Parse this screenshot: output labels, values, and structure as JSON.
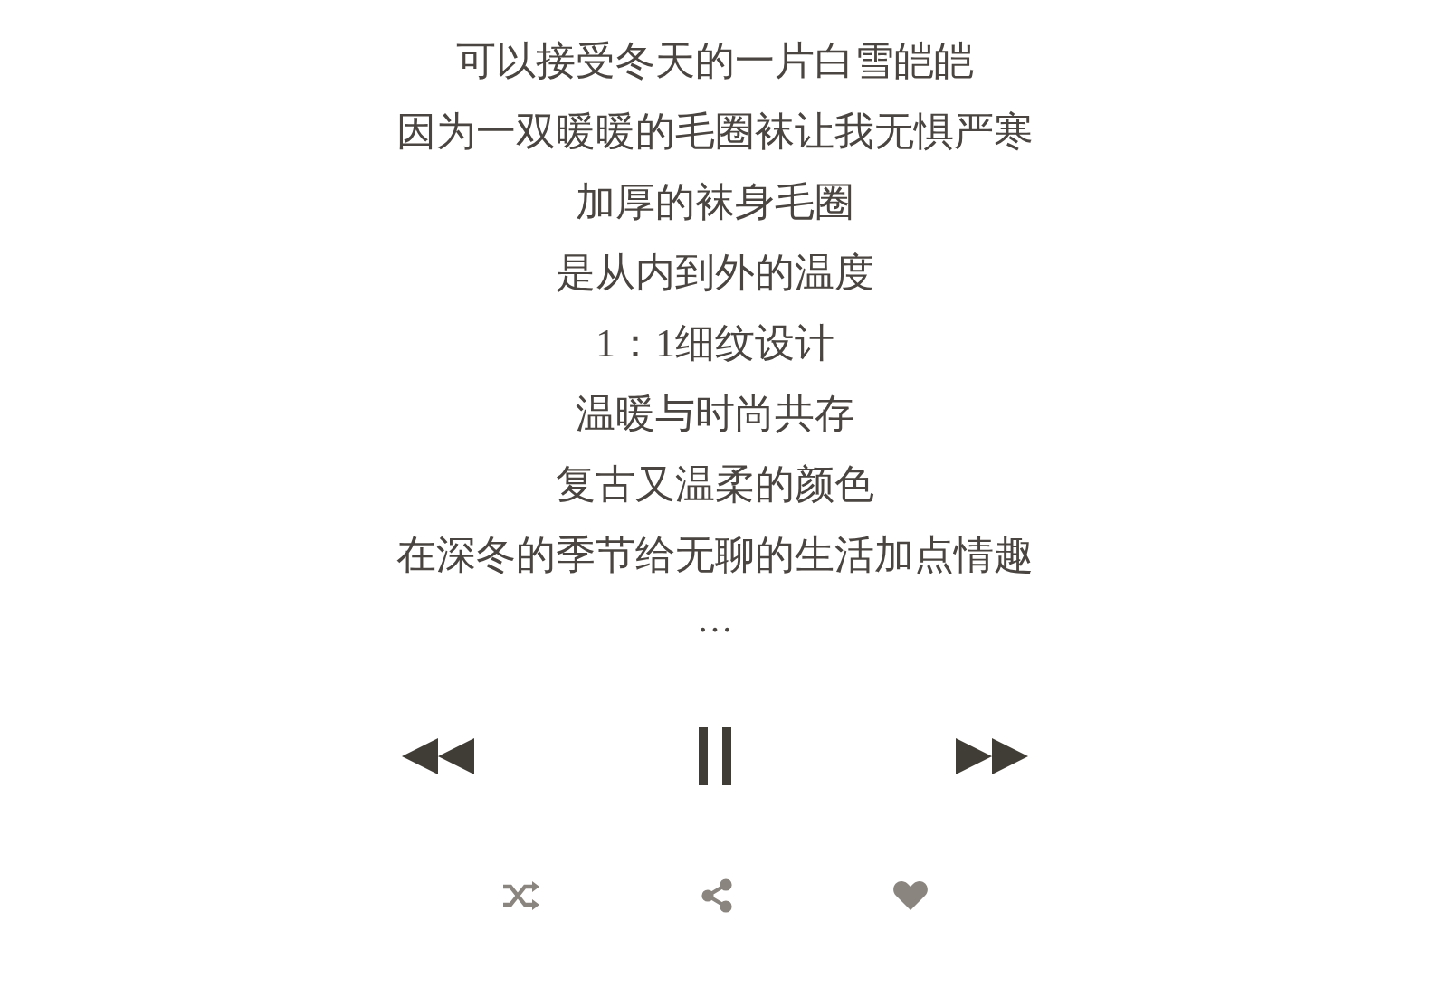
{
  "lyrics": [
    "可以接受冬天的一片白雪皑皑",
    "因为一双暖暖的毛圈袜让我无惧严寒",
    "加厚的袜身毛圈",
    "是从内到外的温度",
    "1：1细纹设计",
    "温暖与时尚共存",
    "复古又温柔的颜色",
    "在深冬的季节给无聊的生活加点情趣"
  ],
  "more": "…",
  "player": {
    "playing": true
  }
}
